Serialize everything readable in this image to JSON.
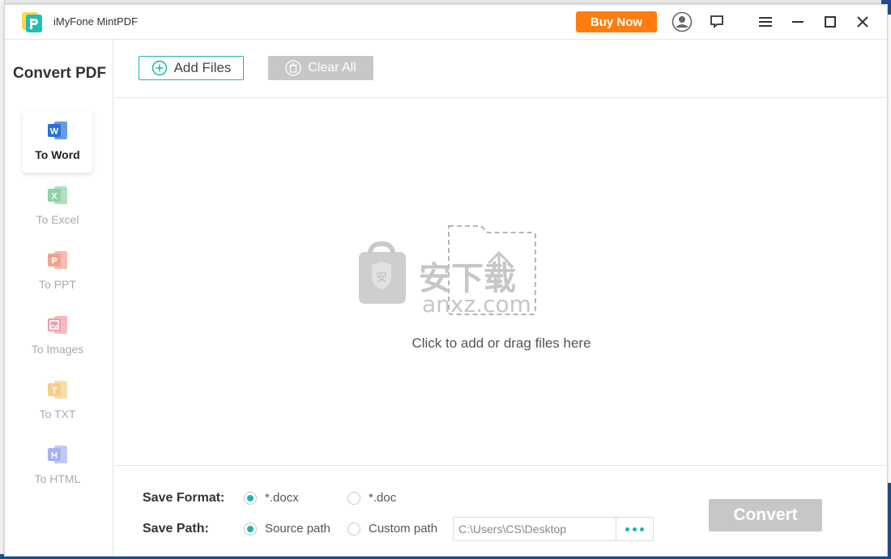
{
  "app": {
    "title": "iMyFone MintPDF",
    "buy_label": "Buy Now"
  },
  "sidebar": {
    "title": "Convert PDF",
    "items": [
      {
        "label": "To Word",
        "letter": "W",
        "color": "#2b6fd6",
        "active": true
      },
      {
        "label": "To Excel",
        "letter": "X",
        "color": "#8fd2a7",
        "active": false
      },
      {
        "label": "To PPT",
        "letter": "P",
        "color": "#f0a392",
        "active": false
      },
      {
        "label": "To Images",
        "letter": "",
        "color": "#ee9ea6",
        "active": false
      },
      {
        "label": "To TXT",
        "letter": "T",
        "color": "#f5cf8a",
        "active": false
      },
      {
        "label": "To HTML",
        "letter": "H",
        "color": "#a5b3ee",
        "active": false
      }
    ]
  },
  "toolbar": {
    "add_label": "Add Files",
    "clear_label": "Clear All"
  },
  "dropzone": {
    "text": "Click to add or drag files here",
    "watermark": "安下载",
    "watermark_sub": "anxz.com"
  },
  "bottom": {
    "format_label": "Save Format:",
    "format_options": [
      "*.docx",
      "*.doc"
    ],
    "path_label": "Save Path:",
    "path_options": [
      "Source path",
      "Custom path"
    ],
    "path_value": "C:\\Users\\CS\\Desktop",
    "convert_label": "Convert"
  },
  "colors": {
    "accent": "#18b6b5",
    "buy": "#ff7d0e",
    "disabled": "#c7c7c7"
  }
}
